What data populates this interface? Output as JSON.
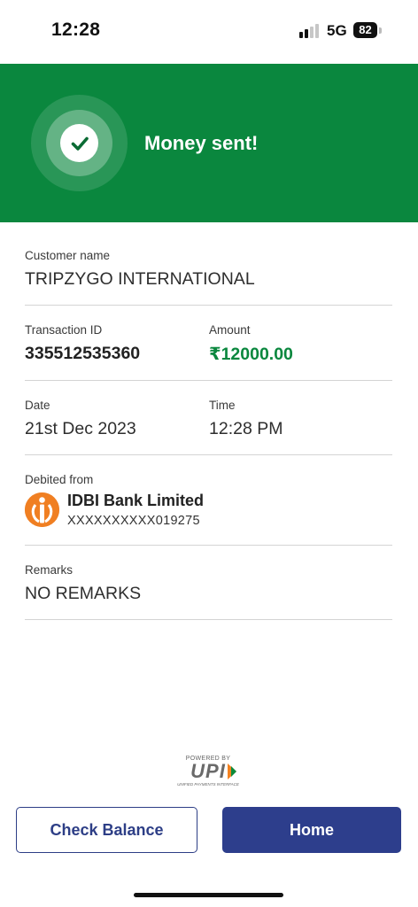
{
  "status_bar": {
    "time": "12:28",
    "network": "5G",
    "battery": "82"
  },
  "banner": {
    "title": "Money sent!",
    "color": "#0a873e"
  },
  "customer": {
    "label": "Customer name",
    "value": "TRIPZYGO INTERNATIONAL"
  },
  "transaction": {
    "id_label": "Transaction ID",
    "id_value": "335512535360",
    "amount_label": "Amount",
    "amount_value": "₹12000.00"
  },
  "datetime": {
    "date_label": "Date",
    "date_value": "21st Dec 2023",
    "time_label": "Time",
    "time_value": "12:28 PM"
  },
  "debit": {
    "label": "Debited from",
    "bank_name": "IDBI Bank Limited",
    "account": "XXXXXXXXXX019275",
    "logo_icon": "idbi-bank-logo"
  },
  "remarks": {
    "label": "Remarks",
    "value": "NO REMARKS"
  },
  "upi": {
    "powered_by": "POWERED BY",
    "word": "UPI",
    "subtitle": "UNIFIED PAYMENTS INTERFACE"
  },
  "buttons": {
    "check_balance": "Check Balance",
    "home": "Home"
  },
  "colors": {
    "accent_green": "#0a873e",
    "primary_blue": "#2d3e8c",
    "bank_orange": "#f07f22"
  }
}
